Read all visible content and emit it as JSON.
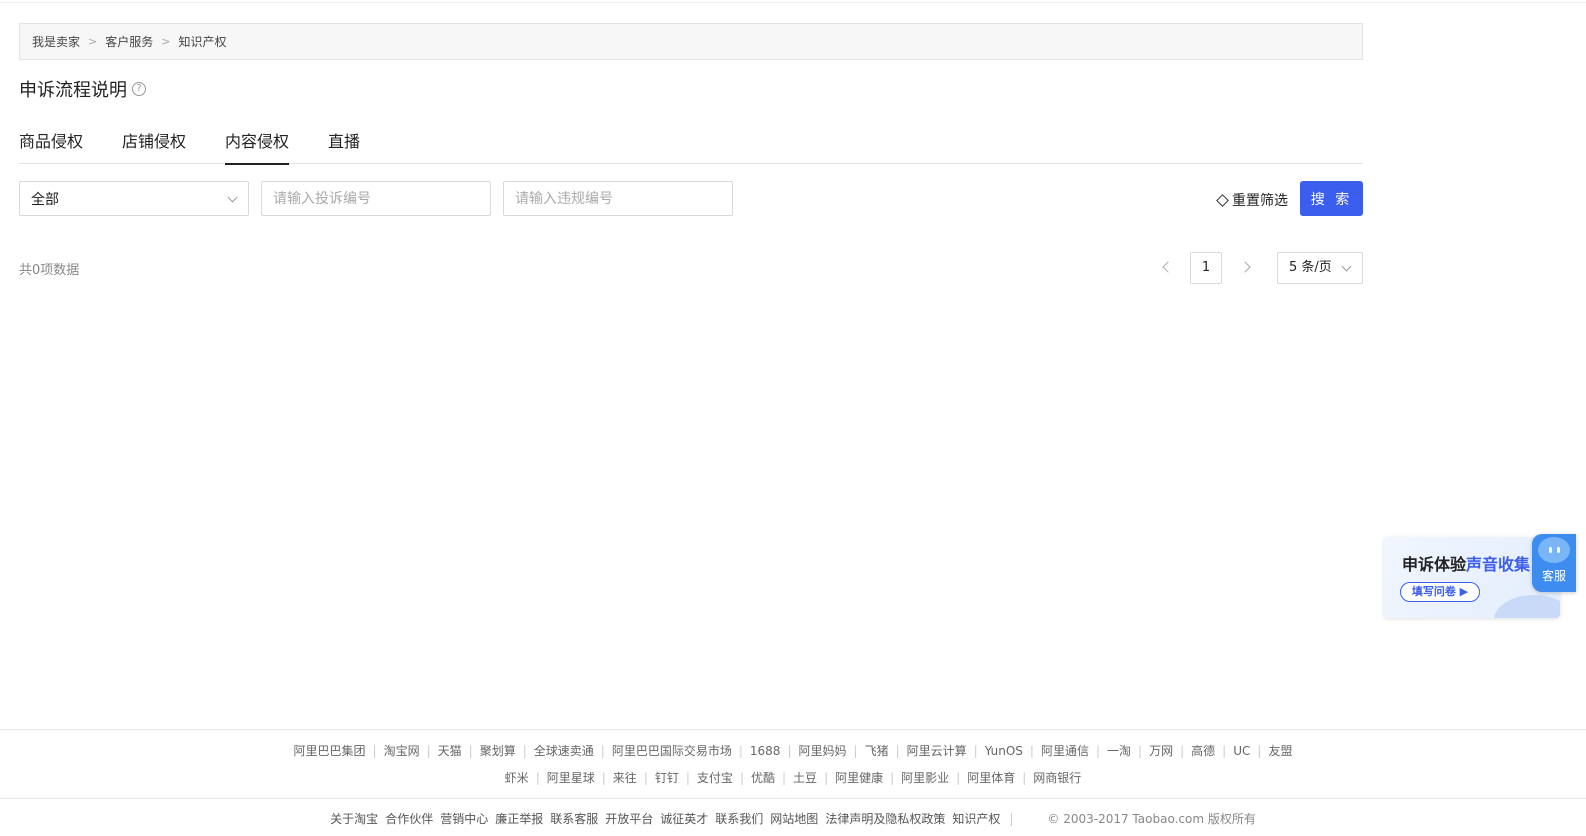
{
  "breadcrumb": [
    "我是卖家",
    "客户服务",
    "知识产权"
  ],
  "breadcrumb_separator": ">",
  "page_title": "申诉流程说明",
  "help_icon_glyph": "?",
  "tabs": [
    "商品侵权",
    "店铺侵权",
    "内容侵权",
    "直播"
  ],
  "active_tab": "内容侵权",
  "filters": {
    "type_select_value": "全部",
    "complaint_placeholder": "请输入投诉编号",
    "violation_placeholder": "请输入违规编号",
    "reset_label": "重置筛选",
    "search_label": "搜 索"
  },
  "results": {
    "total_text": "共0项数据",
    "current_page": "1",
    "page_size": "5 条/页"
  },
  "survey": {
    "title_prefix": "申诉体验",
    "title_highlight": "声音收集",
    "button": "填写问卷 ▶"
  },
  "kefu_label": "客服",
  "footer": {
    "row1": [
      "阿里巴巴集团",
      "淘宝网",
      "天猫",
      "聚划算",
      "全球速卖通",
      "阿里巴巴国际交易市场",
      "1688",
      "阿里妈妈",
      "飞猪",
      "阿里云计算",
      "YunOS",
      "阿里通信",
      "一淘",
      "万网",
      "高德",
      "UC",
      "友盟"
    ],
    "row2": [
      "虾米",
      "阿里星球",
      "来往",
      "钉钉",
      "支付宝",
      "优酷",
      "土豆",
      "阿里健康",
      "阿里影业",
      "阿里体育",
      "网商银行"
    ],
    "bottom_links": [
      "关于淘宝",
      "合作伙伴",
      "营销中心",
      "廉正举报",
      "联系客服",
      "开放平台",
      "诚征英才",
      "联系我们",
      "网站地图",
      "法律声明及隐私权政策",
      "知识产权"
    ],
    "copyright": "© 2003-2017 Taobao.com 版权所有"
  },
  "colors": {
    "primary": "#3c5eef",
    "kefu": "#3d8df0"
  }
}
